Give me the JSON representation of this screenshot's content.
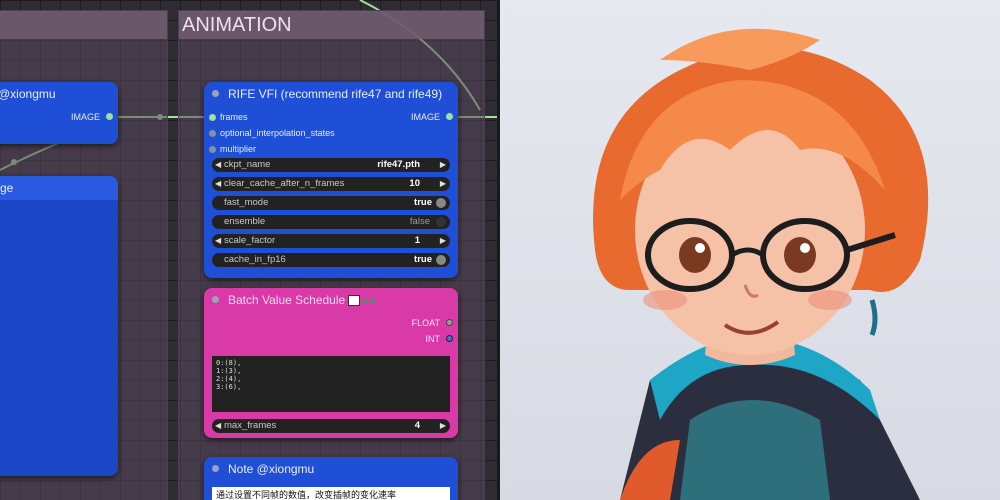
{
  "group": {
    "title": "ANIMATION"
  },
  "left_note": {
    "title": "@xiongmu",
    "output": "IMAGE"
  },
  "left_node2": {
    "title": "ge"
  },
  "rife": {
    "title": "RIFE VFI (recommend rife47 and rife49)",
    "inputs": [
      "frames",
      "optional_interpolation_states",
      "multiplier"
    ],
    "output": "IMAGE",
    "widgets": {
      "ckpt_name": {
        "label": "ckpt_name",
        "value": "rife47.pth"
      },
      "clear_cache": {
        "label": "clear_cache_after_n_frames",
        "value": "10"
      },
      "fast_mode": {
        "label": "fast_mode",
        "value": "true"
      },
      "ensemble": {
        "label": "ensemble",
        "value": "false"
      },
      "scale_factor": {
        "label": "scale_factor",
        "value": "1"
      },
      "cache_in_fp16": {
        "label": "cache_in_fp16",
        "value": "true"
      }
    }
  },
  "batch": {
    "title": "Batch Value Schedule",
    "outputs": [
      "FLOAT",
      "INT"
    ],
    "text": "0:(8),\n1:(3),\n2:(4),\n3:(6),",
    "max_frames": {
      "label": "max_frames",
      "value": "4"
    }
  },
  "note": {
    "title": "Note @xiongmu",
    "text": "通过设置不同帧的数值，改变插帧的变化速率"
  },
  "colors": {
    "node_blue": "#1f4fd6",
    "node_pink": "#d93aa8",
    "link_green": "#9fe09a",
    "hair_orange": "#f07a3a"
  }
}
